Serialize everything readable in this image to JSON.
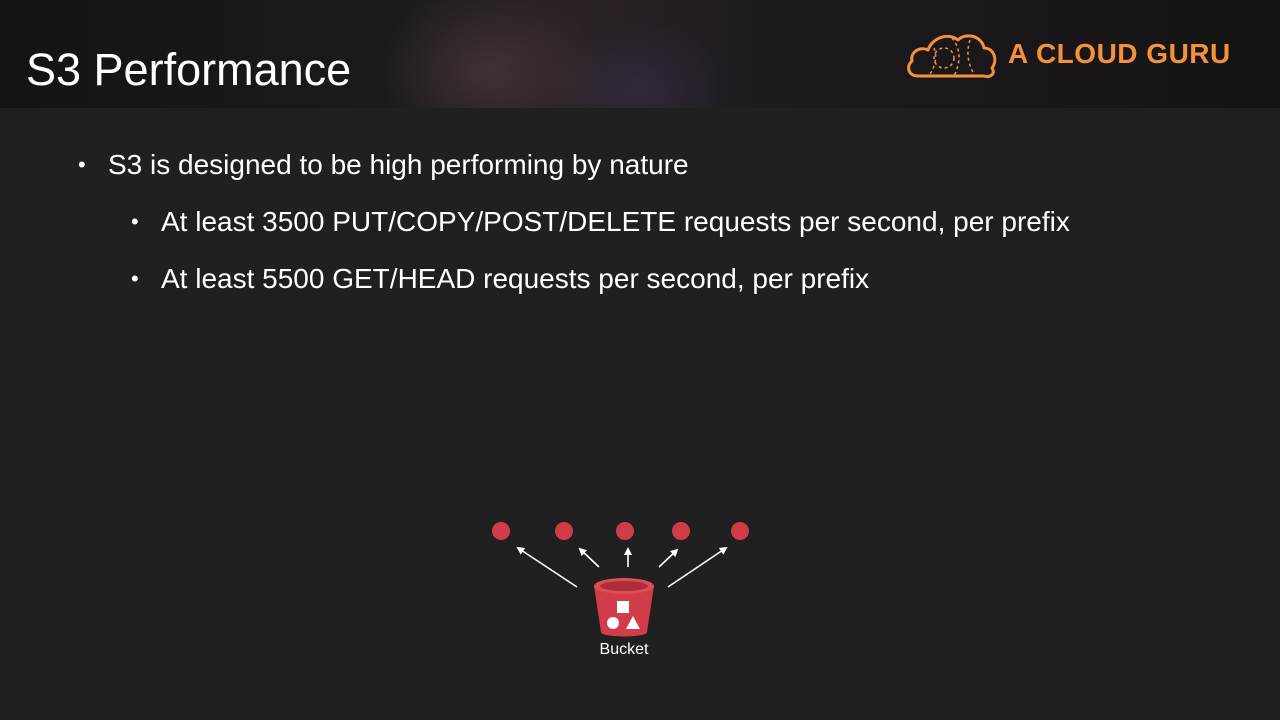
{
  "slide": {
    "title": "S3 Performance",
    "brand": {
      "name": "A CLOUD GURU",
      "color": "#f4913a",
      "icon": "cloud-logo-icon"
    },
    "bullets": [
      {
        "level": 1,
        "text": "S3 is designed to be high performing by nature"
      },
      {
        "level": 2,
        "text": "At least 3500 PUT/COPY/POST/DELETE requests per second, per prefix"
      },
      {
        "level": 2,
        "text": "At least 5500 GET/HEAD requests per second, per prefix"
      }
    ],
    "bullet_glyph": "•",
    "diagram": {
      "bucket_label": "Bucket",
      "bucket_icon": "s3-bucket-icon",
      "node_color": "#d13c48",
      "request_node_count": 5
    }
  }
}
